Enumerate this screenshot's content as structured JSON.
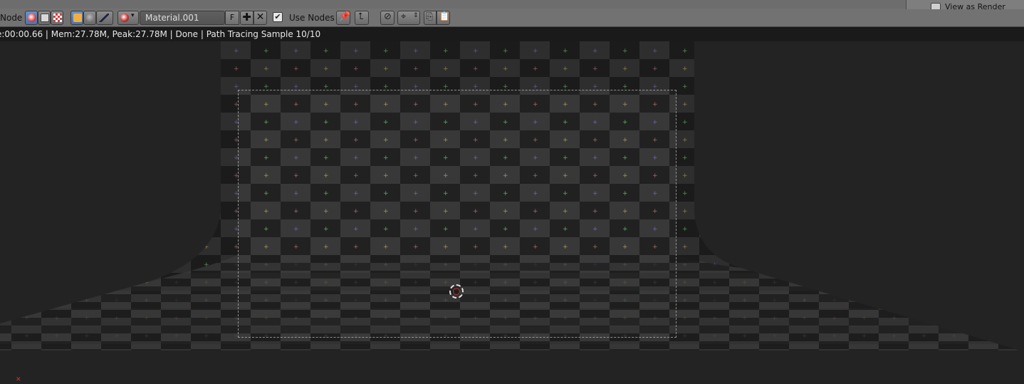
{
  "header": {
    "menu_label": "Node",
    "material_name": "Material.001",
    "fake_user_label": "F",
    "use_nodes_label": "Use Nodes",
    "use_nodes_checked": true
  },
  "icons": [
    "shader-icon",
    "texture-icon",
    "compositing-icon",
    "object-icon",
    "world-icon",
    "linestyle-icon",
    "material-browse-icon",
    "add-icon",
    "close-icon",
    "pin-icon",
    "parent-icon",
    "snap-icon",
    "snap-mode-icon",
    "copy-icon",
    "paste-icon"
  ],
  "right_panel": {
    "label": "View as Render"
  },
  "status_bar": {
    "text": "e:00:00.66 | Mem:27.78M, Peak:27.78M | Done | Path Tracing Sample 10/10"
  },
  "colors": {
    "background": "#232323",
    "header": "#727272",
    "selected": "#5680c2"
  }
}
